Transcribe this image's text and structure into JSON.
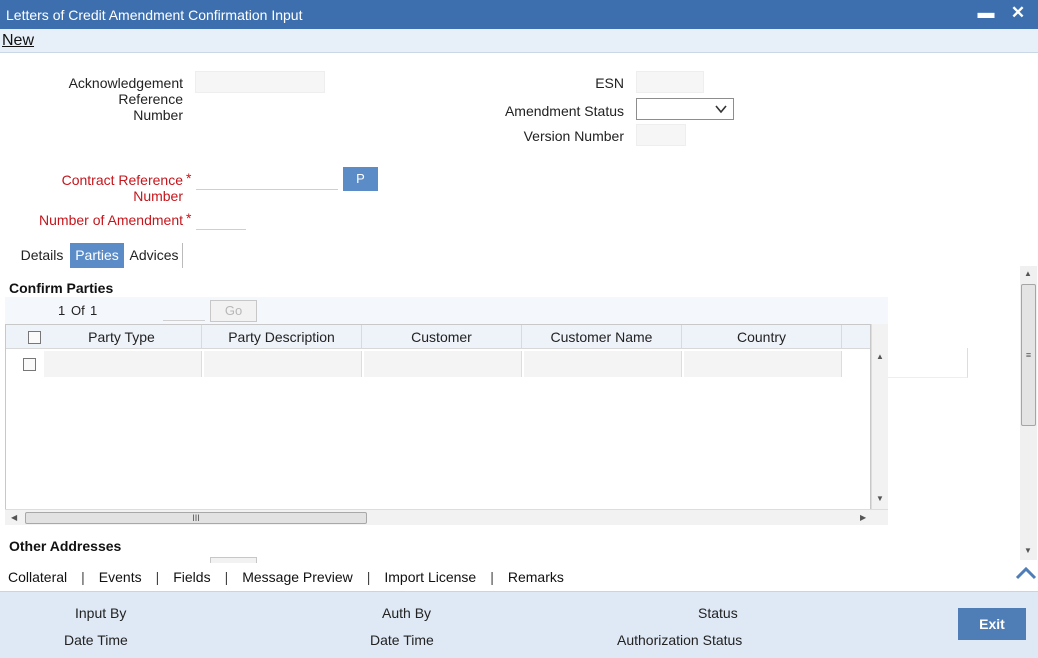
{
  "window": {
    "title": "Letters of Credit Amendment Confirmation Input",
    "minimize": "▬",
    "close": "✕"
  },
  "menu": {
    "new_label": "New"
  },
  "form": {
    "ack_ref_label_1": "Acknowledgement Reference",
    "ack_ref_label_2": "Number",
    "ack_ref_value": "",
    "esn_label": "ESN",
    "esn_value": "",
    "amendment_status_label": "Amendment Status",
    "amendment_status_value": "",
    "version_number_label": "Version Number",
    "version_number_value": "",
    "contract_ref_label": "Contract Reference Number",
    "contract_ref_value": "",
    "p_button": "P",
    "num_amendment_label": "Number of Amendment",
    "num_amendment_value": "",
    "required_mark": "*"
  },
  "tabs": [
    {
      "label": "Details",
      "active": false
    },
    {
      "label": "Parties",
      "active": true
    },
    {
      "label": "Advices",
      "active": false
    }
  ],
  "confirm_parties": {
    "title": "Confirm Parties",
    "pager": {
      "current": "1",
      "of_label": "Of",
      "total": "1",
      "go_label": "Go"
    },
    "columns": [
      "Party Type",
      "Party Description",
      "Customer",
      "Customer Name",
      "Country"
    ],
    "rows": [
      {
        "party_type": "",
        "party_description": "",
        "customer": "",
        "customer_name": "",
        "country": ""
      }
    ],
    "scroll_grip": "III"
  },
  "other_addresses": {
    "title": "Other Addresses"
  },
  "bottom_links": [
    "Collateral",
    "Events",
    "Fields",
    "Message Preview",
    "Import License",
    "Remarks"
  ],
  "bottom_sep": "|",
  "footer": {
    "input_by": "Input By",
    "date_time_1": "Date Time",
    "auth_by": "Auth By",
    "date_time_2": "Date Time",
    "status": "Status",
    "authorization_status": "Authorization Status",
    "exit": "Exit"
  },
  "colors": {
    "titlebar": "#3d6fae",
    "accent": "#5b8cc7",
    "required": "#c4161c",
    "footer": "#dfe9f5"
  }
}
